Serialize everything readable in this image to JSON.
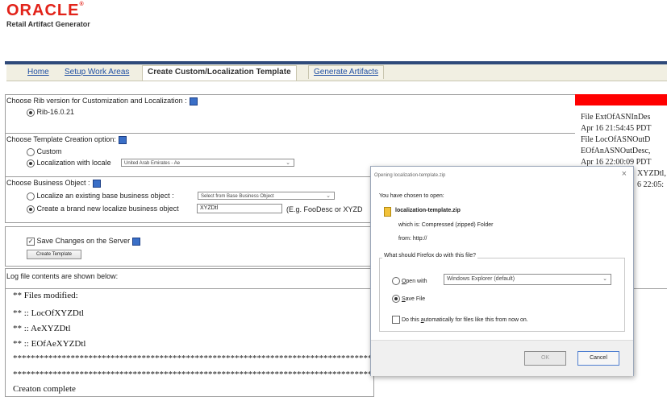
{
  "brand": {
    "logo": "ORACLE",
    "logo_mark": "®",
    "app_title": "Retail Artifact Generator"
  },
  "tabs": {
    "home": "Home",
    "setup": "Setup Work Areas",
    "create": "Create Custom/Localization Template",
    "generate": "Generate Artifacts"
  },
  "rib": {
    "label": "Choose Rib version for Customization and Localization :",
    "option": "Rib-16.0.21"
  },
  "template": {
    "label": "Choose Template Creation option:",
    "custom": "Custom",
    "localization": "Localization with locale",
    "locale_value": "United Arab Emirates - Ae"
  },
  "business": {
    "label": "Choose Business Object :",
    "existing": "Localize an existing base business object :",
    "existing_select": "Select from Base Business Object",
    "new": "Create a brand new localize business object",
    "new_value": "XYZDtl",
    "example": "(E.g. FooDesc or XYZD"
  },
  "save": {
    "label": "Save Changes on the Server",
    "button": "Create Template"
  },
  "log": {
    "label": "Log file contents are shown below:",
    "lines": [
      "** Files modified:",
      "** :: LocOfXYZDtl",
      "** :: AeXYZDtl",
      "** :: EOfAeXYZDtl",
      "************************************************************************************",
      "************************************************************************************",
      "Creaton complete"
    ]
  },
  "right_panel": {
    "lines": [
      "File ExtOfASNInDes",
      "Apr 16 21:54:45 PDT",
      "File LocOfASNOutD",
      "EOfAnASNOutDesc,",
      "Apr 16 22:00:09 PDT",
      "XYZDtl, A",
      "6 22:05:"
    ]
  },
  "dialog": {
    "title": "Opening localization-template.zip",
    "chosen": "You have chosen to open:",
    "filename": "localization-template.zip",
    "which_is_label": "which is:",
    "which_is_value": "Compressed (zipped) Folder",
    "from_label": "from:",
    "from_value": "http://",
    "question": "What should Firefox do with this file?",
    "open_with_prefix": "",
    "open_with_key": "O",
    "open_with_rest": "pen with",
    "open_with_app": "Windows Explorer (default)",
    "save_key": "S",
    "save_rest": "ave File",
    "auto_pre": "Do this ",
    "auto_key": "a",
    "auto_rest": "utomatically for files like this from now on.",
    "ok": "OK",
    "cancel": "Cancel",
    "close": "×"
  },
  "colors": {
    "brand_red": "#e2231a",
    "nav_blue": "#2f4a7a",
    "alert_red": "#ff0000"
  }
}
